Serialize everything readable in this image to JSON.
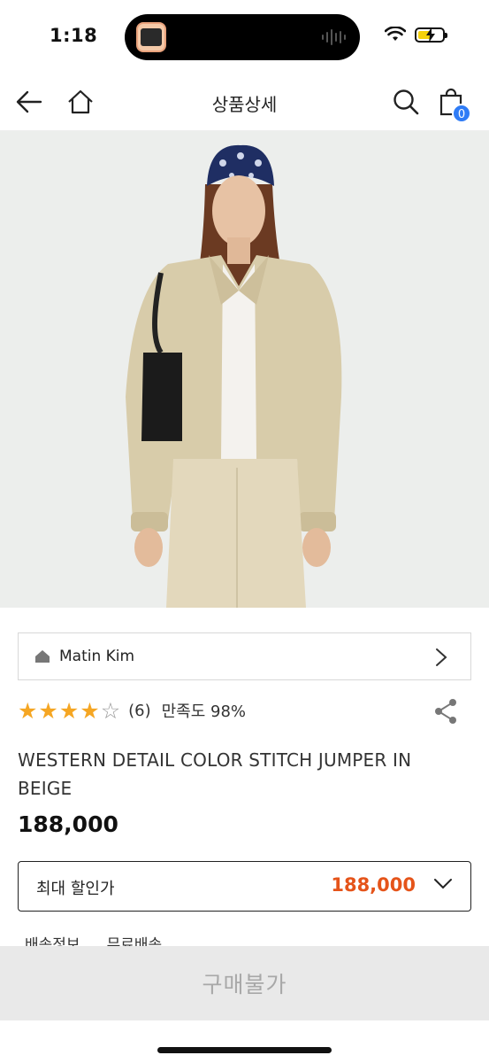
{
  "status_bar": {
    "time": "1:18"
  },
  "header": {
    "title": "상품상세",
    "cart_count": "0"
  },
  "brand": {
    "name": "Matin Kim"
  },
  "rating": {
    "stars": 4.5,
    "review_count": "(6)",
    "satisfaction": "만족도 98%"
  },
  "product": {
    "name": "WESTERN DETAIL COLOR STITCH JUMPER IN BEIGE",
    "price": "188,000"
  },
  "discount": {
    "label": "최대 할인가",
    "price": "188,000"
  },
  "shipping": {
    "label": "배송정보",
    "value": "무료배송"
  },
  "buy_button": {
    "label": "구매불가"
  },
  "colors": {
    "accent_blue": "#2f7cf6",
    "discount_orange": "#e5541a",
    "star_gold": "#f5a623"
  }
}
